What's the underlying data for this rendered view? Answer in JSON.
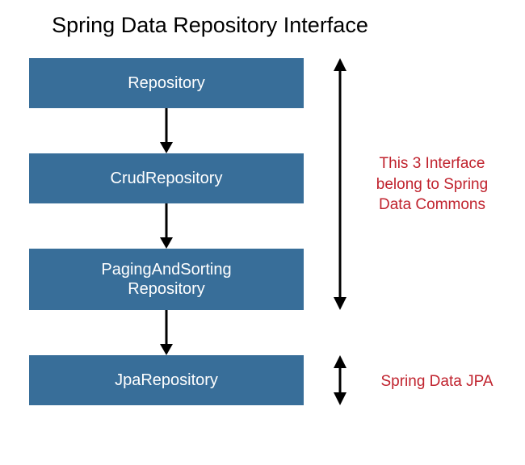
{
  "title": "Spring Data Repository Interface",
  "boxes": {
    "b1": "Repository",
    "b2": "CrudRepository",
    "b3_line1": "PagingAndSorting",
    "b3_line2": "Repository",
    "b4": "JpaRepository"
  },
  "annotations": {
    "top_line1": "This 3 Interface",
    "top_line2": "belong to Spring",
    "top_line3": "Data Commons",
    "bottom": "Spring Data JPA"
  }
}
